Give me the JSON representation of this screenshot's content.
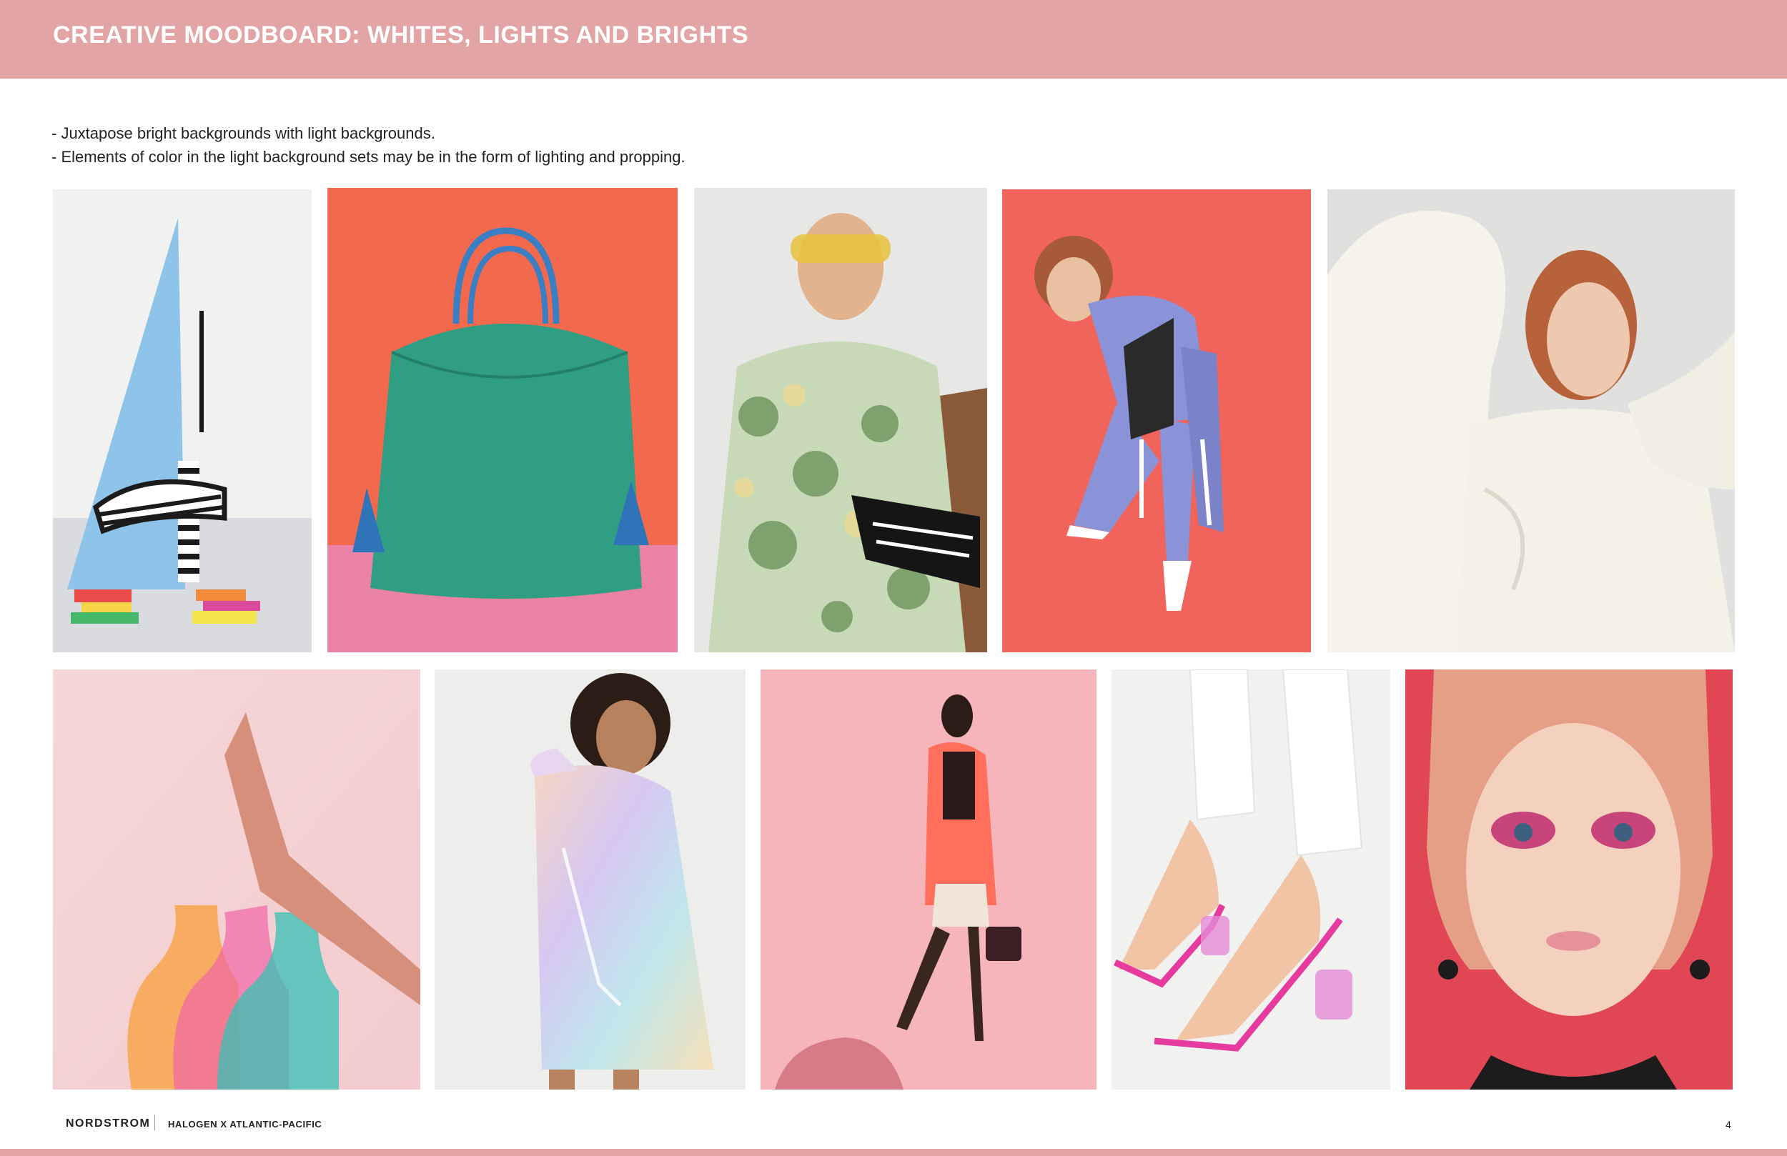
{
  "header": {
    "title": "CREATIVE MOODBOARD: WHITES, LIGHTS AND BRIGHTS",
    "background_color": "#e2a4a5"
  },
  "intro": {
    "lines": [
      " - Juxtapose bright backgrounds with light backgrounds.",
      "- Elements of color in the light background sets may be in the form of lighting and propping."
    ]
  },
  "footer": {
    "brand": "NORDSTROM",
    "collection": "HALOGEN X ATLANTIC-PACIFIC",
    "page_number": "4"
  }
}
